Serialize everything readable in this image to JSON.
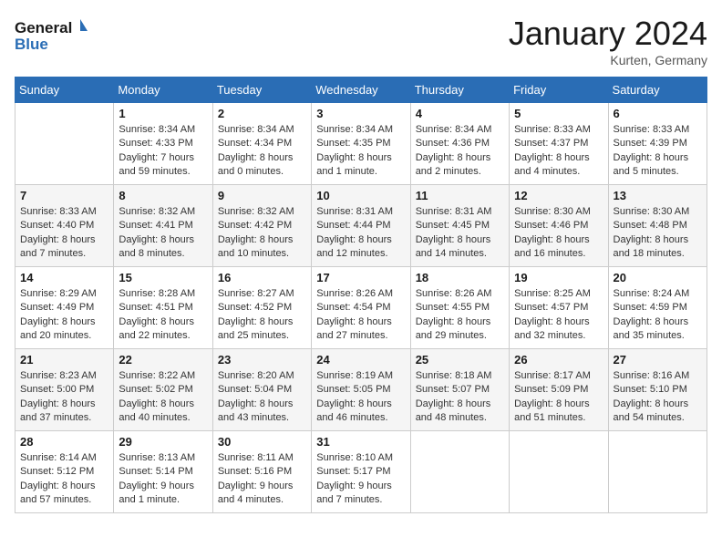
{
  "header": {
    "logo_line1": "General",
    "logo_line2": "Blue",
    "month": "January 2024",
    "location": "Kurten, Germany"
  },
  "columns": [
    "Sunday",
    "Monday",
    "Tuesday",
    "Wednesday",
    "Thursday",
    "Friday",
    "Saturday"
  ],
  "weeks": [
    [
      {
        "day": "",
        "sunrise": "",
        "sunset": "",
        "daylight": ""
      },
      {
        "day": "1",
        "sunrise": "8:34 AM",
        "sunset": "4:33 PM",
        "daylight": "7 hours and 59 minutes."
      },
      {
        "day": "2",
        "sunrise": "8:34 AM",
        "sunset": "4:34 PM",
        "daylight": "8 hours and 0 minutes."
      },
      {
        "day": "3",
        "sunrise": "8:34 AM",
        "sunset": "4:35 PM",
        "daylight": "8 hours and 1 minute."
      },
      {
        "day": "4",
        "sunrise": "8:34 AM",
        "sunset": "4:36 PM",
        "daylight": "8 hours and 2 minutes."
      },
      {
        "day": "5",
        "sunrise": "8:33 AM",
        "sunset": "4:37 PM",
        "daylight": "8 hours and 4 minutes."
      },
      {
        "day": "6",
        "sunrise": "8:33 AM",
        "sunset": "4:39 PM",
        "daylight": "8 hours and 5 minutes."
      }
    ],
    [
      {
        "day": "7",
        "sunrise": "8:33 AM",
        "sunset": "4:40 PM",
        "daylight": "8 hours and 7 minutes."
      },
      {
        "day": "8",
        "sunrise": "8:32 AM",
        "sunset": "4:41 PM",
        "daylight": "8 hours and 8 minutes."
      },
      {
        "day": "9",
        "sunrise": "8:32 AM",
        "sunset": "4:42 PM",
        "daylight": "8 hours and 10 minutes."
      },
      {
        "day": "10",
        "sunrise": "8:31 AM",
        "sunset": "4:44 PM",
        "daylight": "8 hours and 12 minutes."
      },
      {
        "day": "11",
        "sunrise": "8:31 AM",
        "sunset": "4:45 PM",
        "daylight": "8 hours and 14 minutes."
      },
      {
        "day": "12",
        "sunrise": "8:30 AM",
        "sunset": "4:46 PM",
        "daylight": "8 hours and 16 minutes."
      },
      {
        "day": "13",
        "sunrise": "8:30 AM",
        "sunset": "4:48 PM",
        "daylight": "8 hours and 18 minutes."
      }
    ],
    [
      {
        "day": "14",
        "sunrise": "8:29 AM",
        "sunset": "4:49 PM",
        "daylight": "8 hours and 20 minutes."
      },
      {
        "day": "15",
        "sunrise": "8:28 AM",
        "sunset": "4:51 PM",
        "daylight": "8 hours and 22 minutes."
      },
      {
        "day": "16",
        "sunrise": "8:27 AM",
        "sunset": "4:52 PM",
        "daylight": "8 hours and 25 minutes."
      },
      {
        "day": "17",
        "sunrise": "8:26 AM",
        "sunset": "4:54 PM",
        "daylight": "8 hours and 27 minutes."
      },
      {
        "day": "18",
        "sunrise": "8:26 AM",
        "sunset": "4:55 PM",
        "daylight": "8 hours and 29 minutes."
      },
      {
        "day": "19",
        "sunrise": "8:25 AM",
        "sunset": "4:57 PM",
        "daylight": "8 hours and 32 minutes."
      },
      {
        "day": "20",
        "sunrise": "8:24 AM",
        "sunset": "4:59 PM",
        "daylight": "8 hours and 35 minutes."
      }
    ],
    [
      {
        "day": "21",
        "sunrise": "8:23 AM",
        "sunset": "5:00 PM",
        "daylight": "8 hours and 37 minutes."
      },
      {
        "day": "22",
        "sunrise": "8:22 AM",
        "sunset": "5:02 PM",
        "daylight": "8 hours and 40 minutes."
      },
      {
        "day": "23",
        "sunrise": "8:20 AM",
        "sunset": "5:04 PM",
        "daylight": "8 hours and 43 minutes."
      },
      {
        "day": "24",
        "sunrise": "8:19 AM",
        "sunset": "5:05 PM",
        "daylight": "8 hours and 46 minutes."
      },
      {
        "day": "25",
        "sunrise": "8:18 AM",
        "sunset": "5:07 PM",
        "daylight": "8 hours and 48 minutes."
      },
      {
        "day": "26",
        "sunrise": "8:17 AM",
        "sunset": "5:09 PM",
        "daylight": "8 hours and 51 minutes."
      },
      {
        "day": "27",
        "sunrise": "8:16 AM",
        "sunset": "5:10 PM",
        "daylight": "8 hours and 54 minutes."
      }
    ],
    [
      {
        "day": "28",
        "sunrise": "8:14 AM",
        "sunset": "5:12 PM",
        "daylight": "8 hours and 57 minutes."
      },
      {
        "day": "29",
        "sunrise": "8:13 AM",
        "sunset": "5:14 PM",
        "daylight": "9 hours and 1 minute."
      },
      {
        "day": "30",
        "sunrise": "8:11 AM",
        "sunset": "5:16 PM",
        "daylight": "9 hours and 4 minutes."
      },
      {
        "day": "31",
        "sunrise": "8:10 AM",
        "sunset": "5:17 PM",
        "daylight": "9 hours and 7 minutes."
      },
      {
        "day": "",
        "sunrise": "",
        "sunset": "",
        "daylight": ""
      },
      {
        "day": "",
        "sunrise": "",
        "sunset": "",
        "daylight": ""
      },
      {
        "day": "",
        "sunrise": "",
        "sunset": "",
        "daylight": ""
      }
    ]
  ],
  "labels": {
    "sunrise_prefix": "Sunrise: ",
    "sunset_prefix": "Sunset: ",
    "daylight_prefix": "Daylight: "
  }
}
